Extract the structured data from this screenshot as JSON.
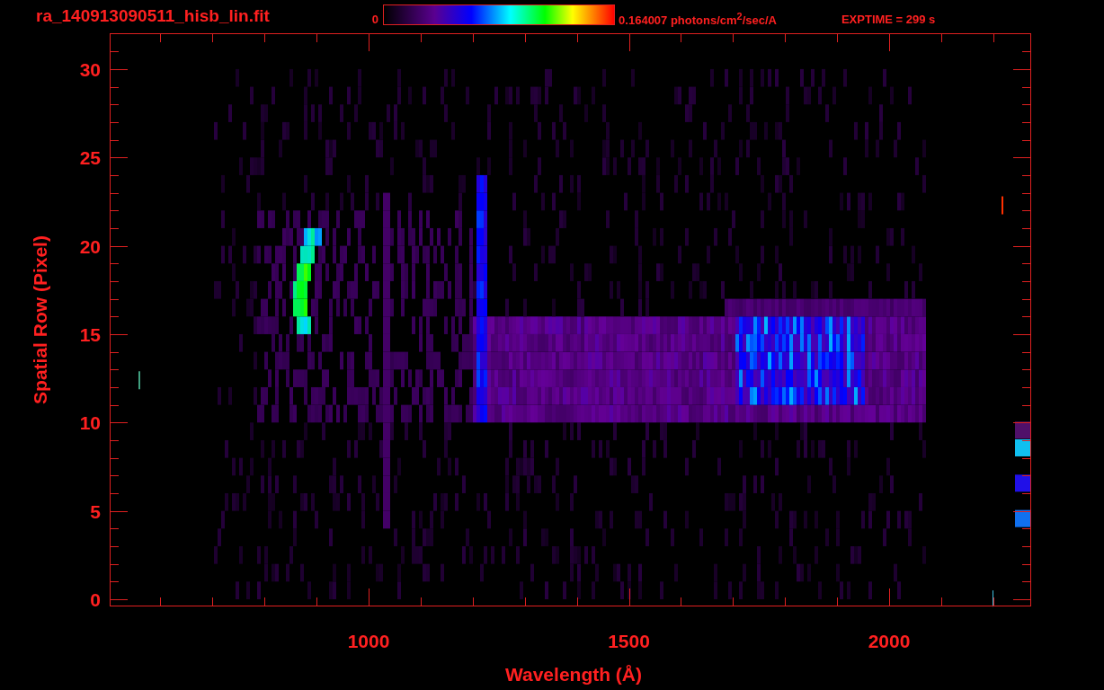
{
  "header": {
    "title": "ra_140913090511_hisb_lin.fit",
    "colorbar": {
      "min_label": "0",
      "max_label": "0.164007 photons/cm$^{2}$/sec/A"
    },
    "exposure": "EXPTIME = 299 s"
  },
  "plot": {
    "ylabel": "Spatial Row (Pixel)",
    "xlabel": "Wavelength (Å)",
    "ytick_labels": [
      "30",
      "25",
      "20",
      "15",
      "10",
      "5",
      "0"
    ],
    "xtick_labels": [
      "1000",
      "1500",
      "2000"
    ]
  }
}
